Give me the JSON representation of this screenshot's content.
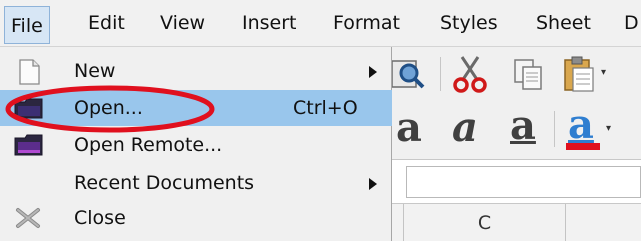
{
  "menubar": {
    "items": [
      {
        "label": "File"
      },
      {
        "label": "Edit"
      },
      {
        "label": "View"
      },
      {
        "label": "Insert"
      },
      {
        "label": "Format"
      },
      {
        "label": "Styles"
      },
      {
        "label": "Sheet"
      },
      {
        "label": "D"
      }
    ]
  },
  "file_menu": {
    "items": [
      {
        "label": "New",
        "icon": "new-document-icon",
        "has_submenu": true
      },
      {
        "label": "Open...",
        "shortcut": "Ctrl+O",
        "icon": "open-folder-icon",
        "highlighted": true
      },
      {
        "label": "Open Remote...",
        "icon": "open-remote-icon"
      },
      {
        "label": "Recent Documents",
        "has_submenu": true
      },
      {
        "label": "Close",
        "icon": "close-icon"
      }
    ]
  },
  "toolbar": {
    "row1_icons": [
      "print-preview-icon",
      "cut-icon",
      "copy-icon",
      "paste-icon"
    ],
    "row2_icons": [
      "font-effect-icon",
      "italic-a-icon",
      "underline-a-icon",
      "font-color-icon"
    ]
  },
  "sheet": {
    "column_headers": [
      "C"
    ]
  },
  "annotation": {
    "color": "#e0101e",
    "target": "Open..."
  },
  "colors": {
    "highlight": "#99c6ec",
    "menu_background": "#f0f0f0",
    "font_color_bar": "#e0101e"
  }
}
